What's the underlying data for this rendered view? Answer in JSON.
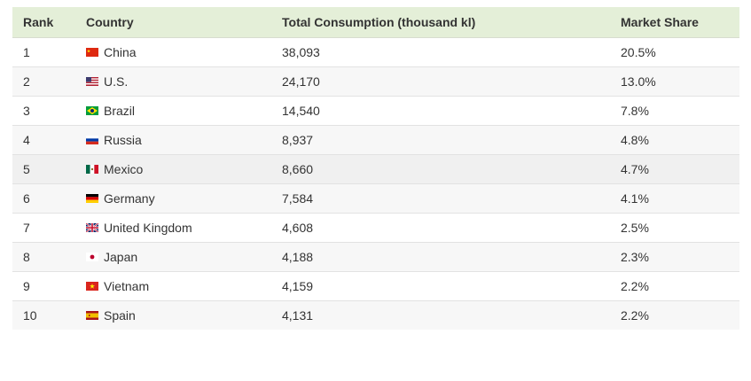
{
  "table": {
    "headers": {
      "rank": "Rank",
      "country": "Country",
      "total": "Total Consumption (thousand kl)",
      "share": "Market Share"
    },
    "rows": [
      {
        "rank": "1",
        "country": "China",
        "flag": "china-flag-icon",
        "total": "38,093",
        "share": "20.5%"
      },
      {
        "rank": "2",
        "country": "U.S.",
        "flag": "us-flag-icon",
        "total": "24,170",
        "share": "13.0%"
      },
      {
        "rank": "3",
        "country": "Brazil",
        "flag": "brazil-flag-icon",
        "total": "14,540",
        "share": "7.8%"
      },
      {
        "rank": "4",
        "country": "Russia",
        "flag": "russia-flag-icon",
        "total": "8,937",
        "share": "4.8%"
      },
      {
        "rank": "5",
        "country": "Mexico",
        "flag": "mexico-flag-icon",
        "total": "8,660",
        "share": "4.7%"
      },
      {
        "rank": "6",
        "country": "Germany",
        "flag": "germany-flag-icon",
        "total": "7,584",
        "share": "4.1%"
      },
      {
        "rank": "7",
        "country": "United Kingdom",
        "flag": "uk-flag-icon",
        "total": "4,608",
        "share": "2.5%"
      },
      {
        "rank": "8",
        "country": "Japan",
        "flag": "japan-flag-icon",
        "total": "4,188",
        "share": "2.3%"
      },
      {
        "rank": "9",
        "country": "Vietnam",
        "flag": "vietnam-flag-icon",
        "total": "4,159",
        "share": "2.2%"
      },
      {
        "rank": "10",
        "country": "Spain",
        "flag": "spain-flag-icon",
        "total": "4,131",
        "share": "2.2%"
      }
    ]
  },
  "colors": {
    "header_bg": "#e4efd8",
    "row_alt_bg": "#f7f7f7",
    "text": "#333333"
  }
}
